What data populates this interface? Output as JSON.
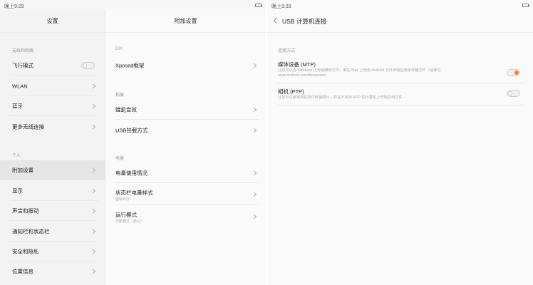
{
  "left_screen": {
    "statusbar": {
      "time": "晚上9:29"
    },
    "main_pane": {
      "title": "设置",
      "sections": [
        {
          "label": "无线和网络"
        },
        {
          "label": "个人"
        }
      ],
      "items": [
        {
          "label": "飞行模式",
          "toggle": "off"
        },
        {
          "label": "WLAN"
        },
        {
          "label": "蓝牙"
        },
        {
          "label": "更多无线连接"
        },
        {
          "label": "附加设置",
          "selected": true
        },
        {
          "label": "显示"
        },
        {
          "label": "声音和振动"
        },
        {
          "label": "通知栏和状态栏"
        },
        {
          "label": "安全和隐私"
        },
        {
          "label": "位置信息"
        }
      ]
    },
    "sub_pane": {
      "title": "附加设置",
      "sections": [
        {
          "label": "DIY"
        },
        {
          "label": "拓展"
        },
        {
          "label": "电量"
        }
      ],
      "items": [
        {
          "label": "Xposed框架"
        },
        {
          "label": "蝰蛇音效"
        },
        {
          "label": "USB挂载方式"
        },
        {
          "label": "电量使用情况"
        },
        {
          "label": "状态栏电量样式",
          "sub": "图标百分"
        },
        {
          "label": "运行模式",
          "sub": "均衡模式（默认）"
        }
      ]
    }
  },
  "right_screen": {
    "statusbar": {
      "time": "晚上9:33"
    },
    "title": "USB 计算机连接",
    "section": "连接方式",
    "options": [
      {
        "label": "媒体设备 (MTP)",
        "desc": "让您可以在 Windows 上传输媒体文件，或在 Mac 上使用 Android 文件传输应用来传输文件（请参见 www.android.com/filetransfer）",
        "toggle": "on"
      },
      {
        "label": "相机 (PTP)",
        "desc": "让您可以使用相机软件传输照片，并在不支持 MTP 的计算机上传输任何文件",
        "toggle": "off"
      }
    ]
  },
  "colors": {
    "accent": "#ff7a1f"
  }
}
